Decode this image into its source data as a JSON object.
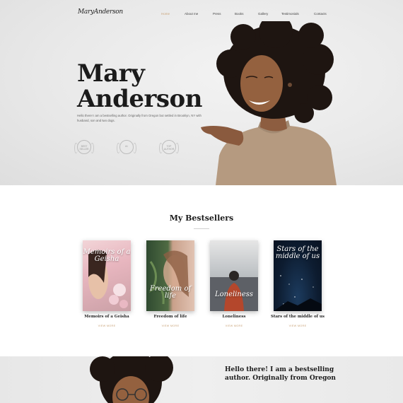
{
  "header": {
    "logo": "MaryAnderson",
    "nav": [
      "Home",
      "About me",
      "Press",
      "Books",
      "Gallery",
      "Testimonials",
      "Contacts"
    ],
    "active_nav": "Home"
  },
  "hero": {
    "title_line1": "Mary",
    "title_line2": "Anderson",
    "intro": "Hello there! I am a bestselling author. Originally from Oregon but settled in Brooklyn, NY with husband, son and two dogs.",
    "badges": [
      {
        "line1": "BEST",
        "line2": "SELLER"
      },
      {
        "line1": "#1",
        "line2": ""
      },
      {
        "line1": "TOP",
        "line2": "AUTHOR"
      }
    ]
  },
  "bestsellers": {
    "heading": "My Bestsellers",
    "link_label": "VIEW MORE",
    "books": [
      {
        "cover_title": "Memoirs of a Geisha",
        "caption": "Memoirs of a Geisha"
      },
      {
        "cover_title": "Freedom of life",
        "caption": "Freedom of life"
      },
      {
        "cover_title": "Loneliness",
        "caption": "Loneliness"
      },
      {
        "cover_title": "Stars of the middle of us",
        "caption": "Stars of the middle of us"
      }
    ]
  },
  "about": {
    "heading_lines": [
      "Hello there! I am a bestselling",
      "author. Originally from Oregon"
    ]
  },
  "colors": {
    "accent": "#c9a47a",
    "heading": "#1b1b1b",
    "hero_bg": "#e9e9e9"
  },
  "icons": [
    "laurel-badge-icon",
    "laurel-badge-icon",
    "laurel-badge-icon"
  ]
}
